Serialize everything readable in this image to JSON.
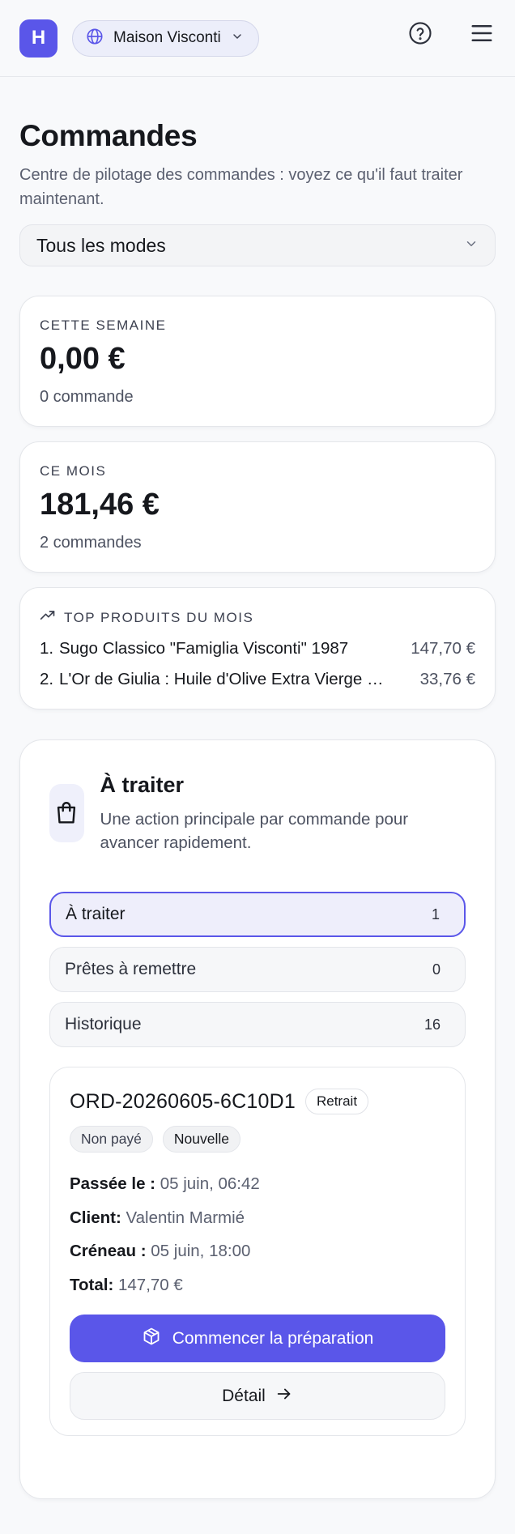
{
  "header": {
    "logo_letter": "H",
    "store_name": "Maison Visconti",
    "icons": [
      "globe-icon",
      "chevron-down-icon",
      "help-icon",
      "menu-icon"
    ]
  },
  "page": {
    "title": "Commandes",
    "subtitle": "Centre de pilotage des commandes : voyez ce qu'il faut traiter maintenant.",
    "mode_select": "Tous les modes"
  },
  "stats": {
    "week": {
      "label": "CETTE SEMAINE",
      "amount": "0,00 €",
      "count": "0 commande"
    },
    "month": {
      "label": "CE MOIS",
      "amount": "181,46 €",
      "count": "2 commandes"
    }
  },
  "top_products": {
    "label": "TOP PRODUITS DU MOIS",
    "items": [
      {
        "idx": "1.",
        "name": "Sugo Classico \"Famiglia Visconti\" 1987",
        "price": "147,70 €"
      },
      {
        "idx": "2.",
        "name": "L'Or de Giulia : Huile d'Olive Extra Vierge Bio",
        "price": "33,76 €"
      }
    ]
  },
  "todo": {
    "title": "À traiter",
    "description": "Une action principale par commande pour avancer rapidement.",
    "tabs": [
      {
        "label": "À traiter",
        "count": "1"
      },
      {
        "label": "Prêtes à remettre",
        "count": "0"
      },
      {
        "label": "Historique",
        "count": "16"
      }
    ]
  },
  "order": {
    "id": "ORD-20260605-6C10D1",
    "mode": "Retrait",
    "payment_status": "Non payé",
    "status": "Nouvelle",
    "placed_label": "Passée le :",
    "placed_value": "05 juin, 06:42",
    "client_label": "Client:",
    "client_value": "Valentin Marmié",
    "slot_label": "Créneau :",
    "slot_value": "05 juin, 18:00",
    "total_label": "Total:",
    "total_value": "147,70 €",
    "primary_action": "Commencer la préparation",
    "secondary_action": "Détail"
  },
  "colors": {
    "accent": "#5a56e9",
    "background": "#f8f9fb"
  }
}
